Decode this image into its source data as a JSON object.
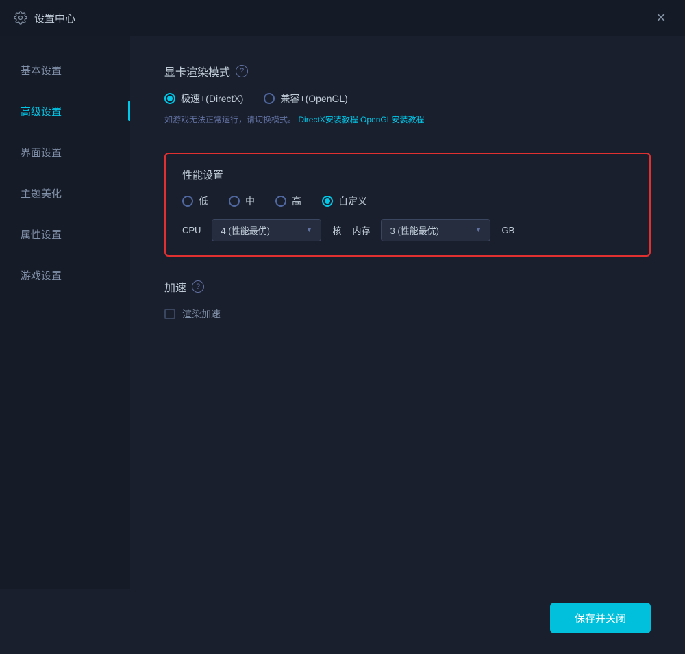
{
  "window": {
    "title": "设置中心",
    "close_label": "✕"
  },
  "sidebar": {
    "items": [
      {
        "id": "basic",
        "label": "基本设置",
        "active": false
      },
      {
        "id": "advanced",
        "label": "高级设置",
        "active": true
      },
      {
        "id": "interface",
        "label": "界面设置",
        "active": false
      },
      {
        "id": "theme",
        "label": "主题美化",
        "active": false
      },
      {
        "id": "attribute",
        "label": "属性设置",
        "active": false
      },
      {
        "id": "game",
        "label": "游戏设置",
        "active": false
      }
    ]
  },
  "content": {
    "gpu_section": {
      "title": "显卡渲染模式",
      "help_icon": "?",
      "options": [
        {
          "id": "directx",
          "label": "极速+(DirectX)",
          "checked": true
        },
        {
          "id": "opengl",
          "label": "兼容+(OpenGL)",
          "checked": false
        }
      ],
      "hint": "如游戏无法正常运行，请切换模式。",
      "link_directx": "DirectX安装教程",
      "link_opengl": "OpenGL安装教程"
    },
    "perf_section": {
      "title": "性能设置",
      "options": [
        {
          "id": "low",
          "label": "低",
          "checked": false
        },
        {
          "id": "mid",
          "label": "中",
          "checked": false
        },
        {
          "id": "high",
          "label": "高",
          "checked": false
        },
        {
          "id": "custom",
          "label": "自定义",
          "checked": true
        }
      ],
      "cpu_label": "CPU",
      "cpu_value": "4 (性能最优)",
      "cpu_unit": "核",
      "mem_label": "内存",
      "mem_value": "3 (性能最优)",
      "mem_unit": "GB"
    },
    "accel_section": {
      "title": "加速",
      "help_icon": "?",
      "checkbox_label": "渲染加速",
      "checked": false
    }
  },
  "footer": {
    "save_label": "保存并关闭"
  }
}
